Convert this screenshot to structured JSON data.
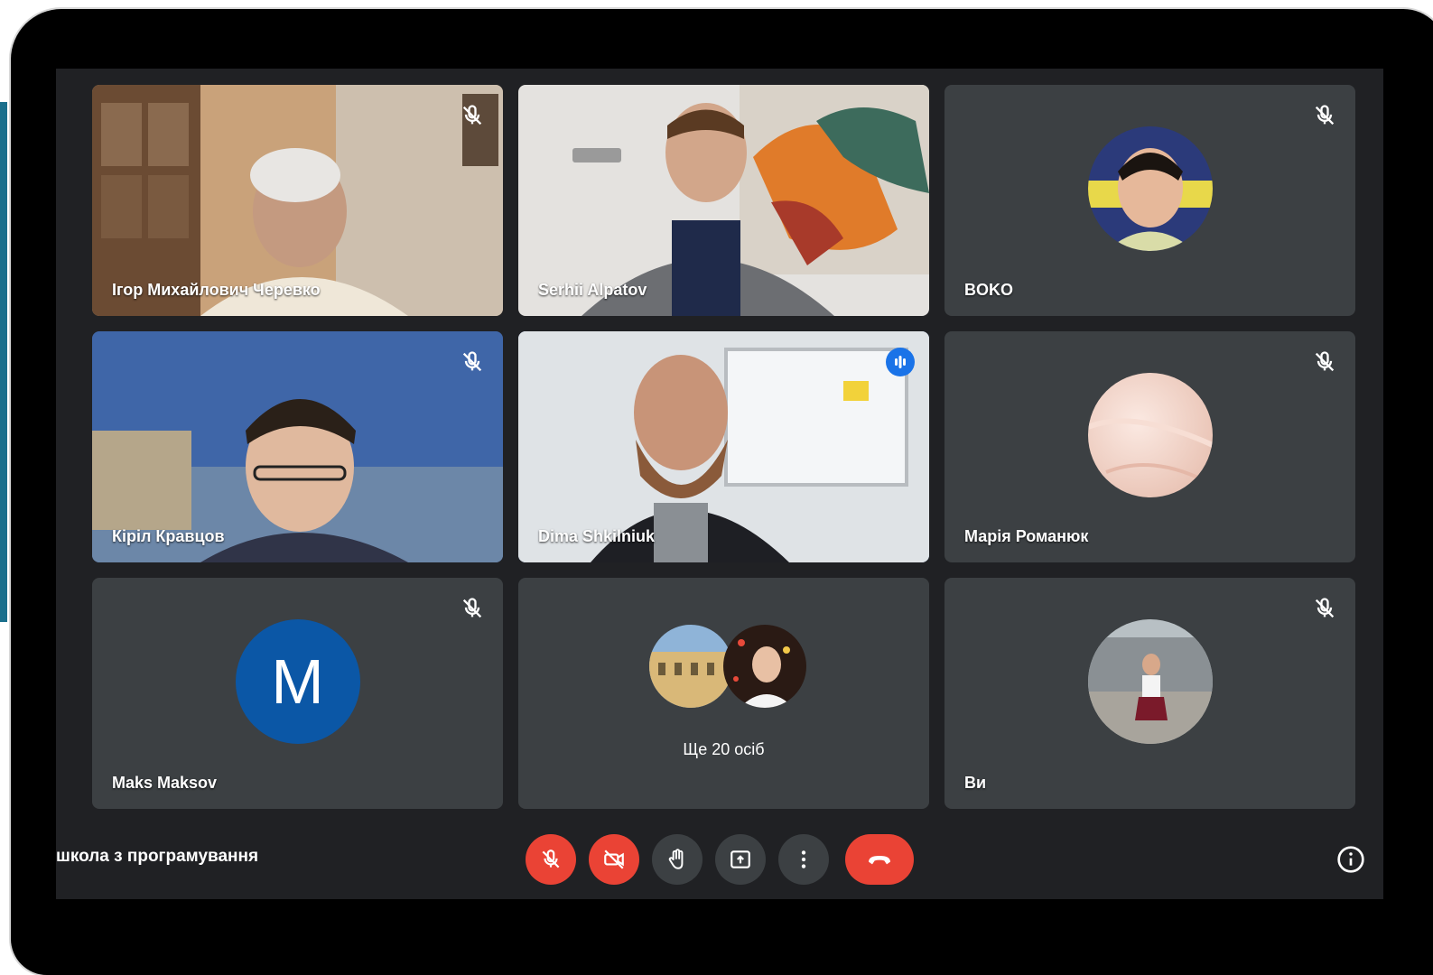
{
  "meeting": {
    "title": "школа з програмування"
  },
  "participants": [
    {
      "name": "Ігор Михайлович Черевко",
      "muted": true,
      "type": "video"
    },
    {
      "name": "Serhii Alpatov",
      "muted": false,
      "type": "video"
    },
    {
      "name": "BOKO",
      "muted": true,
      "type": "avatar"
    },
    {
      "name": "Кірiл Кравцов",
      "muted": true,
      "type": "video"
    },
    {
      "name": "Dima Shkilniuk",
      "muted": false,
      "type": "video",
      "speaking": true
    },
    {
      "name": "Марія Романюк",
      "muted": true,
      "type": "avatar"
    },
    {
      "name": "Maks Maksov",
      "muted": true,
      "type": "letter",
      "initial": "M"
    },
    {
      "name": "",
      "type": "more"
    },
    {
      "name": "Ви",
      "muted": true,
      "type": "avatar"
    }
  ],
  "more_tile": {
    "label": "Ще 20 осіб"
  },
  "controls": [
    {
      "id": "mic",
      "icon": "mic-off-icon",
      "state": "off"
    },
    {
      "id": "camera",
      "icon": "videocam-off-icon",
      "state": "off"
    },
    {
      "id": "raise-hand",
      "icon": "hand-icon"
    },
    {
      "id": "present",
      "icon": "present-screen-icon"
    },
    {
      "id": "more-options",
      "icon": "more-vert-icon"
    },
    {
      "id": "leave-call",
      "icon": "call-end-icon"
    }
  ],
  "colors": {
    "background": "#202124",
    "tile": "#3c4043",
    "danger": "#ea4335",
    "active_border": "#8ab4f8",
    "speaking_badge": "#1a73e8",
    "avatar_blue": "#0b57a6"
  }
}
